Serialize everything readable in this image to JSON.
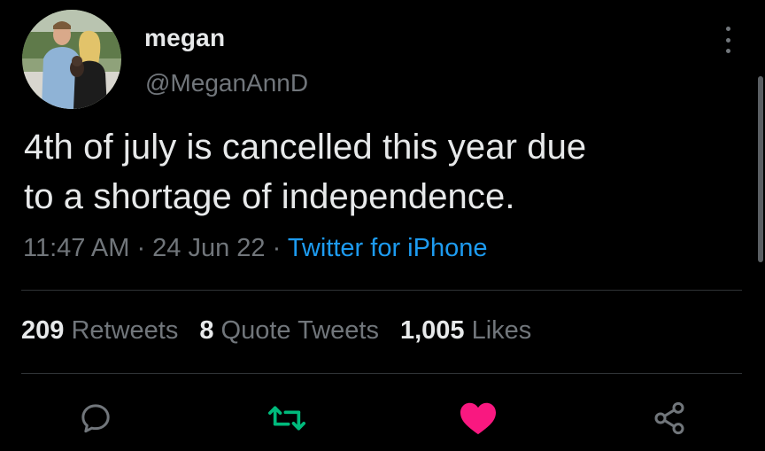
{
  "user": {
    "display_name": "megan",
    "handle": "@MeganAnnD"
  },
  "tweet": {
    "text_line1": "4th of july is cancelled this year due",
    "text_line2": "to a shortage of independence.",
    "time": "11:47 AM",
    "separator": " · ",
    "date": "24 Jun 22",
    "source": "Twitter for iPhone"
  },
  "stats": {
    "retweets_count": "209",
    "retweets_label": "Retweets",
    "quotes_count": "8",
    "quotes_label": "Quote Tweets",
    "likes_count": "1,005",
    "likes_label": "Likes"
  },
  "icons": {
    "reply": "reply-icon",
    "retweet": "retweet-icon",
    "like": "heart-icon",
    "share": "share-icon",
    "more": "more-vertical-icon"
  },
  "colors": {
    "background": "#000000",
    "text": "#e7e9ea",
    "muted": "#71767b",
    "link": "#1d9bf0",
    "retweet_active": "#00ba7c",
    "like_active": "#f91880"
  }
}
